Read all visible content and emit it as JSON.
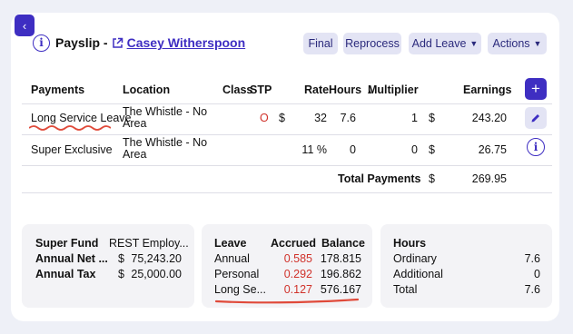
{
  "header": {
    "back_icon": "chevron-left-icon",
    "info_symbol": "i",
    "title_prefix": "Payslip -",
    "employee_name": "Casey Witherspoon",
    "external_icon": "external-link-icon"
  },
  "toolbar": {
    "final_label": "Final",
    "reprocess_label": "Reprocess",
    "add_leave_label": "Add Leave",
    "actions_label": "Actions"
  },
  "payments": {
    "columns": [
      "Payments",
      "Location",
      "Class",
      "STP",
      "Rate",
      "Hours",
      "Multiplier",
      "Earnings"
    ],
    "hours_sort_indicator": "▲",
    "add_button": "+",
    "rows": [
      {
        "payment": "Long Service Leave",
        "location": "The Whistle - No Area",
        "class": "",
        "stp": "O",
        "rate_prefix": "$",
        "rate": "32",
        "hours": "7.6",
        "multiplier": "1",
        "earnings_prefix": "$",
        "earnings": "243.20",
        "action_icon": "pencil-icon"
      },
      {
        "payment": "Super Exclusive",
        "location": "The Whistle - No Area",
        "class": "",
        "stp": "",
        "rate_prefix": "",
        "rate": "11 %",
        "hours": "0",
        "multiplier": "0",
        "earnings_prefix": "$",
        "earnings": "26.75",
        "action_icon": "info-icon"
      }
    ],
    "total_label": "Total Payments",
    "total_prefix": "$",
    "total_value": "269.95"
  },
  "super_card": {
    "rows": [
      {
        "label": "Super Fund",
        "prefix": "",
        "value": "REST Employ..."
      },
      {
        "label": "Annual Net ...",
        "prefix": "$",
        "value": "75,243.20"
      },
      {
        "label": "Annual Tax",
        "prefix": "$",
        "value": "25,000.00"
      }
    ]
  },
  "leave_card": {
    "headers": [
      "Leave",
      "Accrued",
      "Balance"
    ],
    "rows": [
      {
        "leave": "Annual",
        "accrued": "0.585",
        "balance": "178.815"
      },
      {
        "leave": "Personal",
        "accrued": "0.292",
        "balance": "196.862"
      },
      {
        "leave": "Long Se...",
        "accrued": "0.127",
        "balance": "576.167"
      }
    ]
  },
  "hours_card": {
    "header": "Hours",
    "rows": [
      {
        "label": "Ordinary",
        "value": "7.6"
      },
      {
        "label": "Additional",
        "value": "0"
      },
      {
        "label": "Total",
        "value": "7.6"
      }
    ]
  },
  "colors": {
    "accent": "#3e2ec2",
    "button_bg": "#e3e4f4",
    "red": "#d0322b",
    "page_bg": "#eef0f7"
  }
}
